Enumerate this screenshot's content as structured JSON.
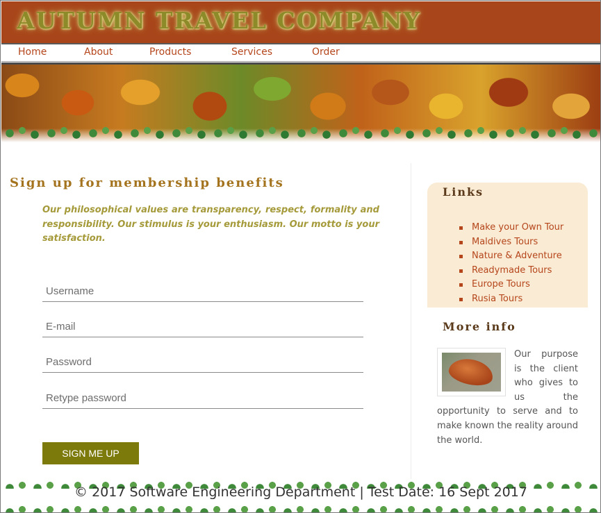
{
  "header": {
    "logo_text": "AUTUMN TRAVEL COMPANY"
  },
  "nav": {
    "items": [
      "Home",
      "About",
      "Products",
      "Services",
      "Order"
    ]
  },
  "main": {
    "heading": "Sign up for membership benefits",
    "intro": "Our philosophical values are transparency, respect, formality and responsibility. Our stimulus is your enthusiasm. Our motto is your satisfaction.",
    "form": {
      "username_placeholder": "Username",
      "email_placeholder": "E-mail",
      "password_placeholder": "Password",
      "retype_placeholder": "Retype password",
      "submit_label": "SIGN ME UP"
    }
  },
  "sidebar": {
    "links_title": "Links",
    "links": [
      "Make your Own Tour",
      "Maldives Tours",
      "Nature & Adventure",
      "Readymade Tours",
      "Europe Tours",
      "Rusia Tours"
    ],
    "info_title": "More info",
    "info_text": "Our purpose is the client who gives to us the opportunity to serve and to make known the reality around the world."
  },
  "footer": {
    "text": "© 2017 Software Engineering Department | Test Date: 16 Sept 2017"
  },
  "colors": {
    "header_bg": "#a8451a",
    "accent": "#b5461c",
    "button_bg": "#7d7a0c",
    "links_bg": "#faebd4"
  }
}
